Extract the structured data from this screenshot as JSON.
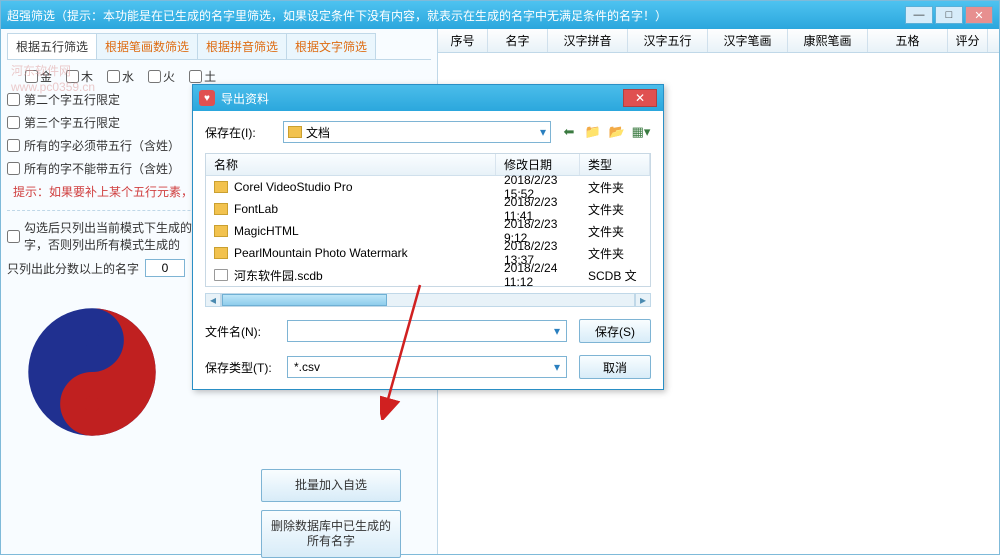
{
  "main_window": {
    "title": "超强筛选（提示：本功能是在已生成的名字里筛选，如果设定条件下没有内容，就表示在生成的名字中无满足条件的名字！）",
    "watermark_l1": "河东软件网",
    "watermark_l2": "www.pc0359.cn"
  },
  "tabs": {
    "t1": "根据五行筛选",
    "t2": "根据笔画数筛选",
    "t3": "根据拼音筛选",
    "t4": "根据文字筛选"
  },
  "wuxing_items": [
    "金",
    "木",
    "水",
    "火",
    "土"
  ],
  "options": {
    "o1": "第二个字五行限定",
    "o2": "第三个字五行限定",
    "o3": "所有的字必须带五行（含姓）",
    "o4": "所有的字不能带五行（含姓）",
    "hint": "提示：如果要补上某个五行元素，一般无需指定五行出现的顺序。",
    "o5": "勾选后只列出当前模式下生成的名字，否则列出所有模式生成的",
    "score_label": "只列出此分数以上的名字",
    "score_value": "0"
  },
  "buttons": {
    "batch": "批量加入自选",
    "delete": "删除数据库中已生成的所有名字"
  },
  "grid": {
    "c1": "序号",
    "c2": "名字",
    "c3": "汉字拼音",
    "c4": "汉字五行",
    "c5": "汉字笔画",
    "c6": "康熙笔画",
    "c7": "五格",
    "c8": "评分"
  },
  "dialog": {
    "title": "导出资料",
    "save_in": "保存在(I):",
    "folder": "文档",
    "hdr_name": "名称",
    "hdr_date": "修改日期",
    "hdr_kind": "类型",
    "files": [
      {
        "name": "Corel VideoStudio Pro",
        "date": "2018/2/23 15:52",
        "kind": "文件夹",
        "ico": "folder"
      },
      {
        "name": "FontLab",
        "date": "2018/2/23 11:41",
        "kind": "文件夹",
        "ico": "folder"
      },
      {
        "name": "MagicHTML",
        "date": "2018/2/23 9:12",
        "kind": "文件夹",
        "ico": "folder"
      },
      {
        "name": "PearlMountain Photo Watermark",
        "date": "2018/2/23 13:37",
        "kind": "文件夹",
        "ico": "folder"
      },
      {
        "name": "河东软件园.scdb",
        "date": "2018/2/24 11:12",
        "kind": "SCDB 文",
        "ico": "db"
      }
    ],
    "fn_label": "文件名(N):",
    "fn_value": "",
    "ft_label": "保存类型(T):",
    "ft_value": "*.csv",
    "save_btn": "保存(S)",
    "cancel_btn": "取消"
  }
}
